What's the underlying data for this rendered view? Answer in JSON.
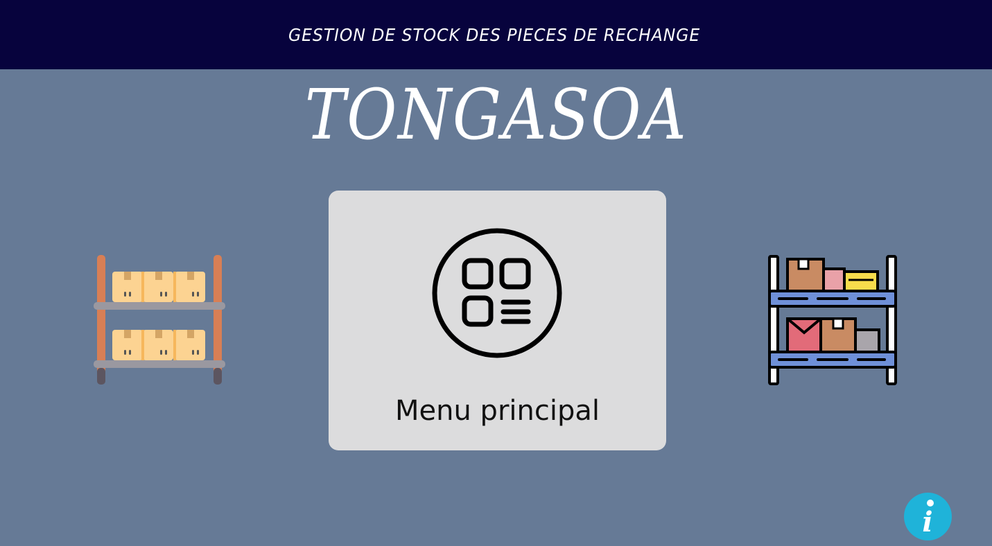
{
  "header": {
    "title": "GESTION DE STOCK DES PIECES DE RECHANGE"
  },
  "brand": {
    "name": "TONGASOA"
  },
  "main": {
    "menu_label": "Menu principal",
    "menu_icon": "grid-menu-icon"
  },
  "decorations": {
    "left_icon": "warehouse-shelf-icon",
    "right_icon": "inventory-shelf-icon"
  },
  "info": {
    "icon": "info-icon",
    "glyph": "i"
  },
  "colors": {
    "background": "#667a96",
    "header_bg": "#07033d",
    "card_bg": "#dcdcdd",
    "info_bg": "#1fb3d9"
  }
}
